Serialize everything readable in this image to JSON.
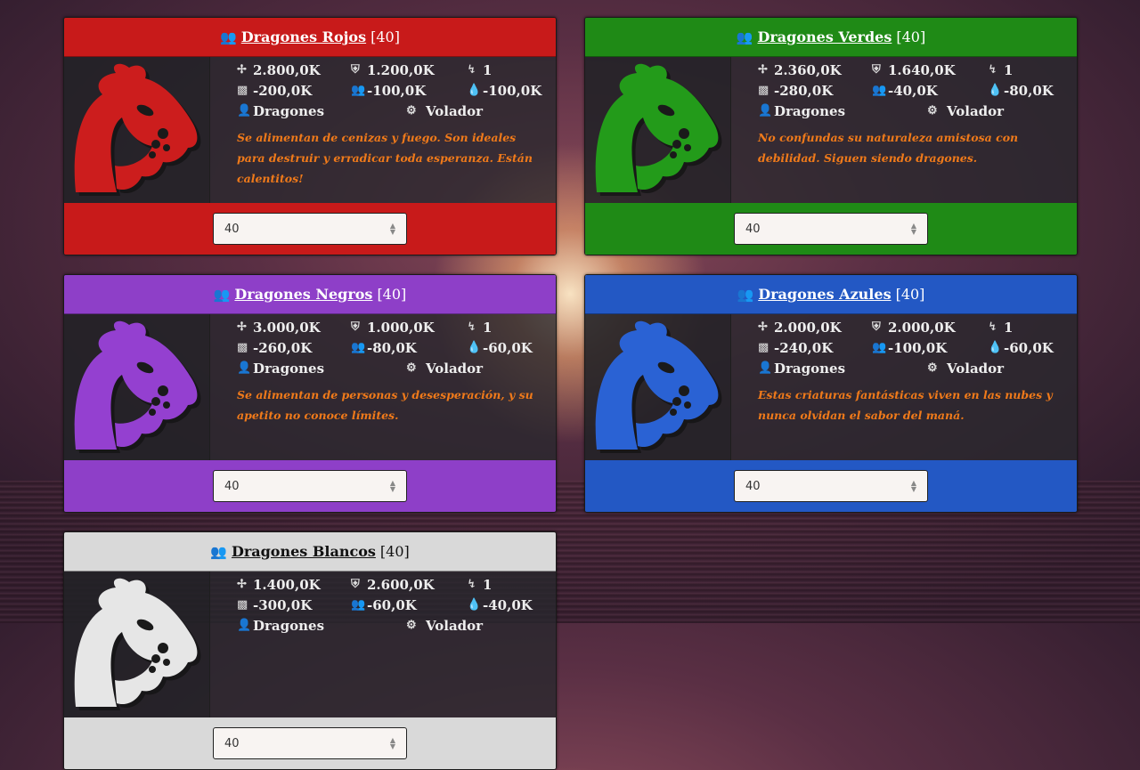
{
  "cards": [
    {
      "title": "Dragones Rojos",
      "count": "[40]",
      "color": "#c81a1a",
      "body_tint": "#cc1d1d",
      "attack": "2.800,0K",
      "defense": "1.200,0K",
      "speed": "1",
      "cost_gold": "-200,0K",
      "cost_pop": "-100,0K",
      "cost_mana": "-100,0K",
      "category": "Dragones",
      "type": "Volador",
      "description": "Se alimentan de cenizas y fuego. Son ideales para destruir y erradicar toda esperanza. Están calentitos!",
      "input_value": "40"
    },
    {
      "title": "Dragones Verdes",
      "count": "[40]",
      "color": "#1f8a16",
      "body_tint": "#239b1a",
      "attack": "2.360,0K",
      "defense": "1.640,0K",
      "speed": "1",
      "cost_gold": "-280,0K",
      "cost_pop": "-40,0K",
      "cost_mana": "-80,0K",
      "category": "Dragones",
      "type": "Volador",
      "description": "No confundas su naturaleza amistosa con debilidad. Siguen siendo dragones.",
      "input_value": "40"
    },
    {
      "title": "Dragones Negros",
      "count": "[40]",
      "color": "#8e3fc8",
      "body_tint": "#9440d0",
      "attack": "3.000,0K",
      "defense": "1.000,0K",
      "speed": "1",
      "cost_gold": "-260,0K",
      "cost_pop": "-80,0K",
      "cost_mana": "-60,0K",
      "category": "Dragones",
      "type": "Volador",
      "description": "Se alimentan de personas y desesperación, y su apetito no conoce límites.",
      "input_value": "40"
    },
    {
      "title": "Dragones Azules",
      "count": "[40]",
      "color": "#2358c4",
      "body_tint": "#2a62d4",
      "attack": "2.000,0K",
      "defense": "2.000,0K",
      "speed": "1",
      "cost_gold": "-240,0K",
      "cost_pop": "-100,0K",
      "cost_mana": "-60,0K",
      "category": "Dragones",
      "type": "Volador",
      "description": "Estas criaturas fantásticas viven en las nubes y nunca olvidan el sabor del maná.",
      "input_value": "40"
    },
    {
      "title": "Dragones Blancos",
      "count": "[40]",
      "color": "#d9d9d9",
      "body_tint": "#e6e6e6",
      "attack": "1.400,0K",
      "defense": "2.600,0K",
      "speed": "1",
      "cost_gold": "-300,0K",
      "cost_pop": "-60,0K",
      "cost_mana": "-40,0K",
      "category": "Dragones",
      "type": "Volador",
      "description": "",
      "input_value": "40"
    }
  ],
  "icons": {
    "users": "users-icon",
    "attack": "crosshair-icon",
    "defense": "shield-icon",
    "speed": "bolt-icon",
    "gold": "money-icon",
    "population": "users-icon",
    "mana": "drop-icon",
    "category": "user-icon",
    "type": "cogs-icon"
  }
}
